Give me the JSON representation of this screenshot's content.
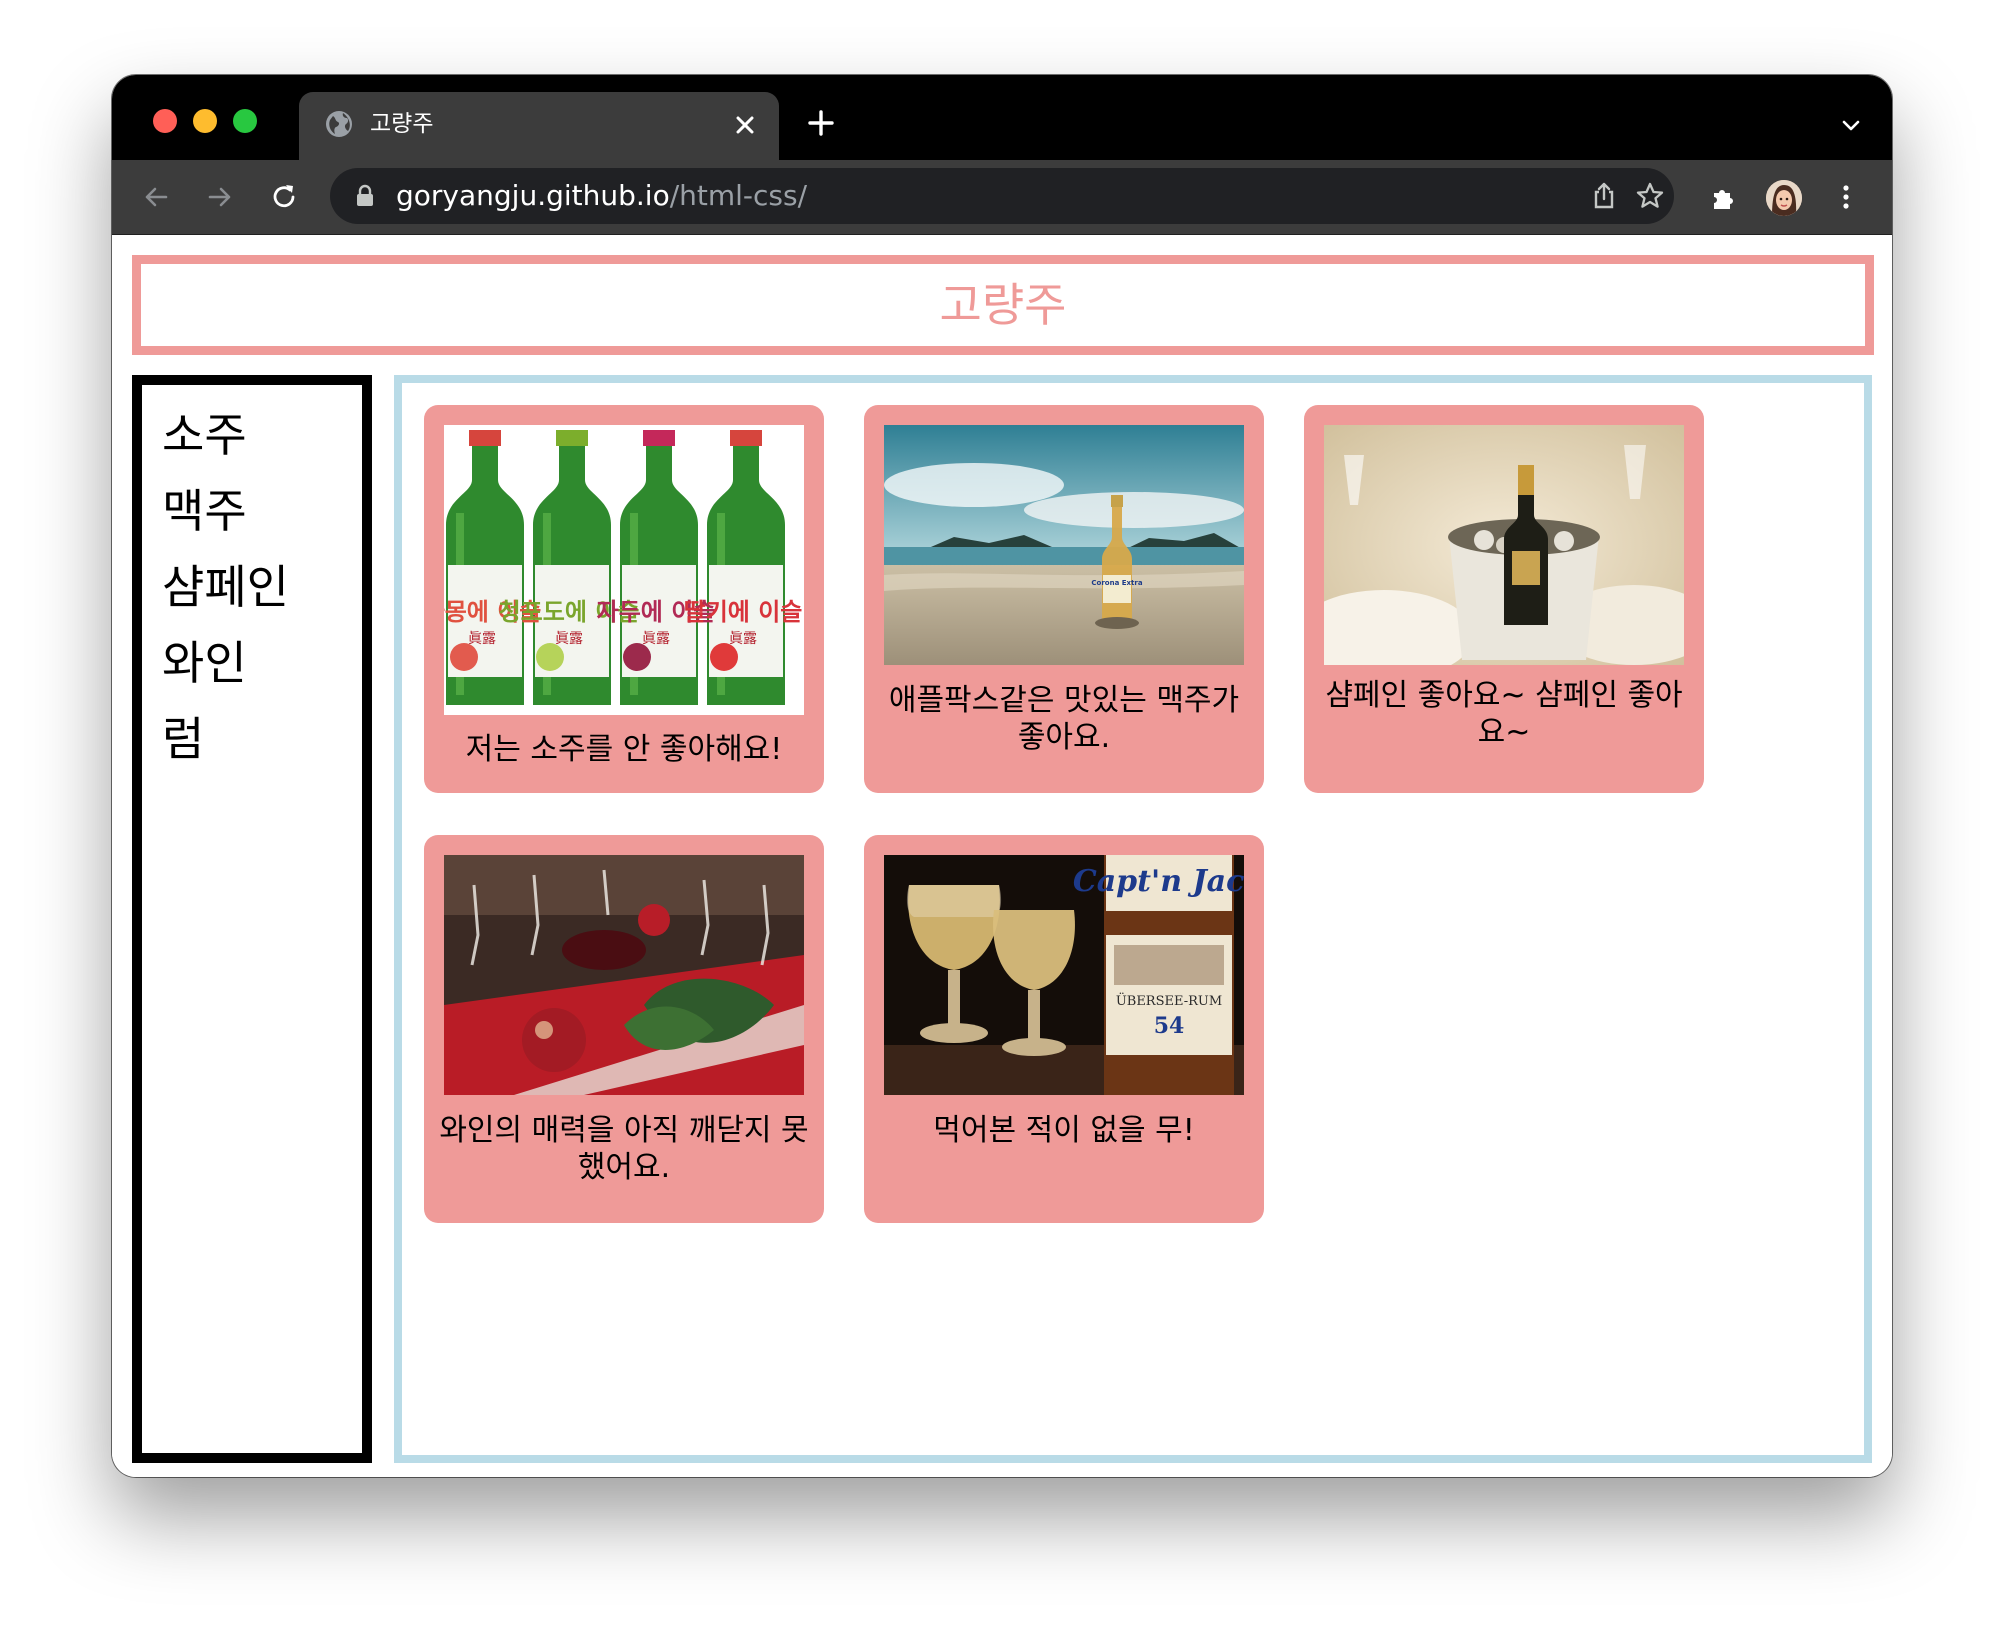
{
  "browser": {
    "tab_title": "고량주",
    "url_host": "goryangju.github.io",
    "url_path": "/html-css/",
    "icons": [
      "globe-icon",
      "close-icon",
      "plus-icon",
      "chevron-down-icon",
      "back-arrow-icon",
      "forward-arrow-icon",
      "reload-icon",
      "lock-icon",
      "share-icon",
      "star-icon",
      "puzzle-icon",
      "avatar",
      "more-vert-icon"
    ]
  },
  "site": {
    "title": "고량주"
  },
  "nav": {
    "items": [
      "소주",
      "맥주",
      "샴페인",
      "와인",
      "럼"
    ]
  },
  "cards": [
    {
      "caption": "저는 소주를 안 좋아해요!",
      "image": "soju-bottles"
    },
    {
      "caption": "애플팍스같은 맛있는 맥주가 좋아요.",
      "image": "beer-on-beach"
    },
    {
      "caption": "샴페인 좋아요~ 샴페인 좋아요~",
      "image": "champagne-in-ice-bucket"
    },
    {
      "caption": "와인의 매력을 아직 깨닫지 못했어요.",
      "image": "wine-glasses-table"
    },
    {
      "caption": "먹어본 적이 없을 무!",
      "image": "rum-bottle-glasses"
    }
  ],
  "image_labels": {
    "soju_brand": "眞露",
    "soju_labels": [
      "자몽에 이슬",
      "청포도에 이슬",
      "자두에 이슬",
      "딸기에 이슬"
    ],
    "beer_brand": "Corona Extra",
    "rum_brand": "Capt'n Jack",
    "rum_sub": "ÜBERSEE-RUM",
    "rum_number": "54"
  },
  "colors": {
    "card_bg": "#ef9a98",
    "header_border": "#ef9a98",
    "nav_border": "#000000",
    "content_border": "#b9dbe7"
  }
}
